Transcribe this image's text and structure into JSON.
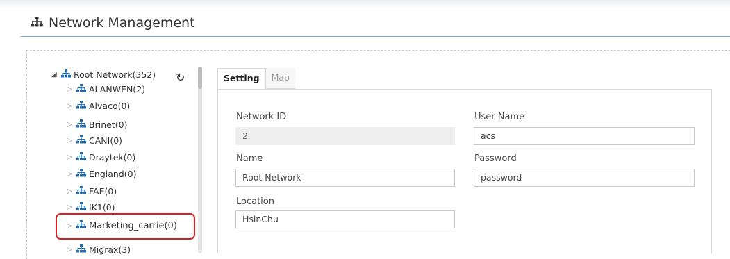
{
  "page": {
    "title": "Network Management"
  },
  "tree": {
    "root": "Root Network(352)",
    "items": [
      {
        "label": "ALANWEN(2)"
      },
      {
        "label": "Alvaco(0)"
      },
      {
        "label": "Brinet(0)"
      },
      {
        "label": "CANI(0)"
      },
      {
        "label": "Draytek(0)"
      },
      {
        "label": "England(0)"
      },
      {
        "label": "FAE(0)"
      },
      {
        "label": "IK1(0)"
      },
      {
        "label": "Marketing_carrie(0)"
      },
      {
        "label": "Migrax(3)"
      }
    ],
    "refresh_icon": "refresh-icon",
    "node_icon": "network-icon",
    "highlight_color": "#e01e1e"
  },
  "tabs": [
    {
      "label": "Setting",
      "active": true
    },
    {
      "label": "Map",
      "active": false
    }
  ],
  "form": {
    "network_id": {
      "label": "Network ID",
      "value": "2"
    },
    "name": {
      "label": "Name",
      "value": "Root Network"
    },
    "location": {
      "label": "Location",
      "value": "HsinChu"
    },
    "user_name": {
      "label": "User Name",
      "value": "acs"
    },
    "password": {
      "label": "Password",
      "value": "password"
    }
  },
  "colors": {
    "accent": "#1f6fb8",
    "rule": "#6aa3d8"
  }
}
